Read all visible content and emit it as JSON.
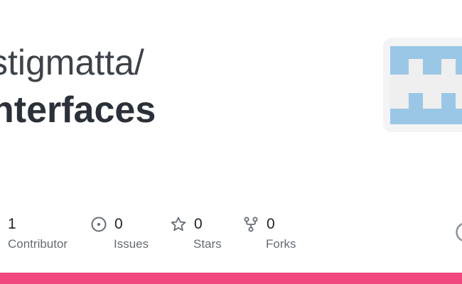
{
  "repo": {
    "owner": "stigmatta/",
    "name": "nterfaces"
  },
  "stats": [
    {
      "key": "contributors",
      "icon": "people-icon",
      "value": "1",
      "label": "Contributor"
    },
    {
      "key": "issues",
      "icon": "issue-opened-icon",
      "value": "0",
      "label": "Issues"
    },
    {
      "key": "stars",
      "icon": "star-icon",
      "value": "0",
      "label": "Stars"
    },
    {
      "key": "forks",
      "icon": "repo-forked-icon",
      "value": "0",
      "label": "Forks"
    }
  ],
  "avatar": {
    "icon": "identicon-avatar",
    "colors": {
      "background": "#f3f4f6",
      "blocks": "#9ac7e6",
      "light": "#efefef"
    }
  },
  "colors": {
    "accent_bar": "#f0477c",
    "muted_text": "#656d76",
    "title_text": "#2b3138"
  }
}
